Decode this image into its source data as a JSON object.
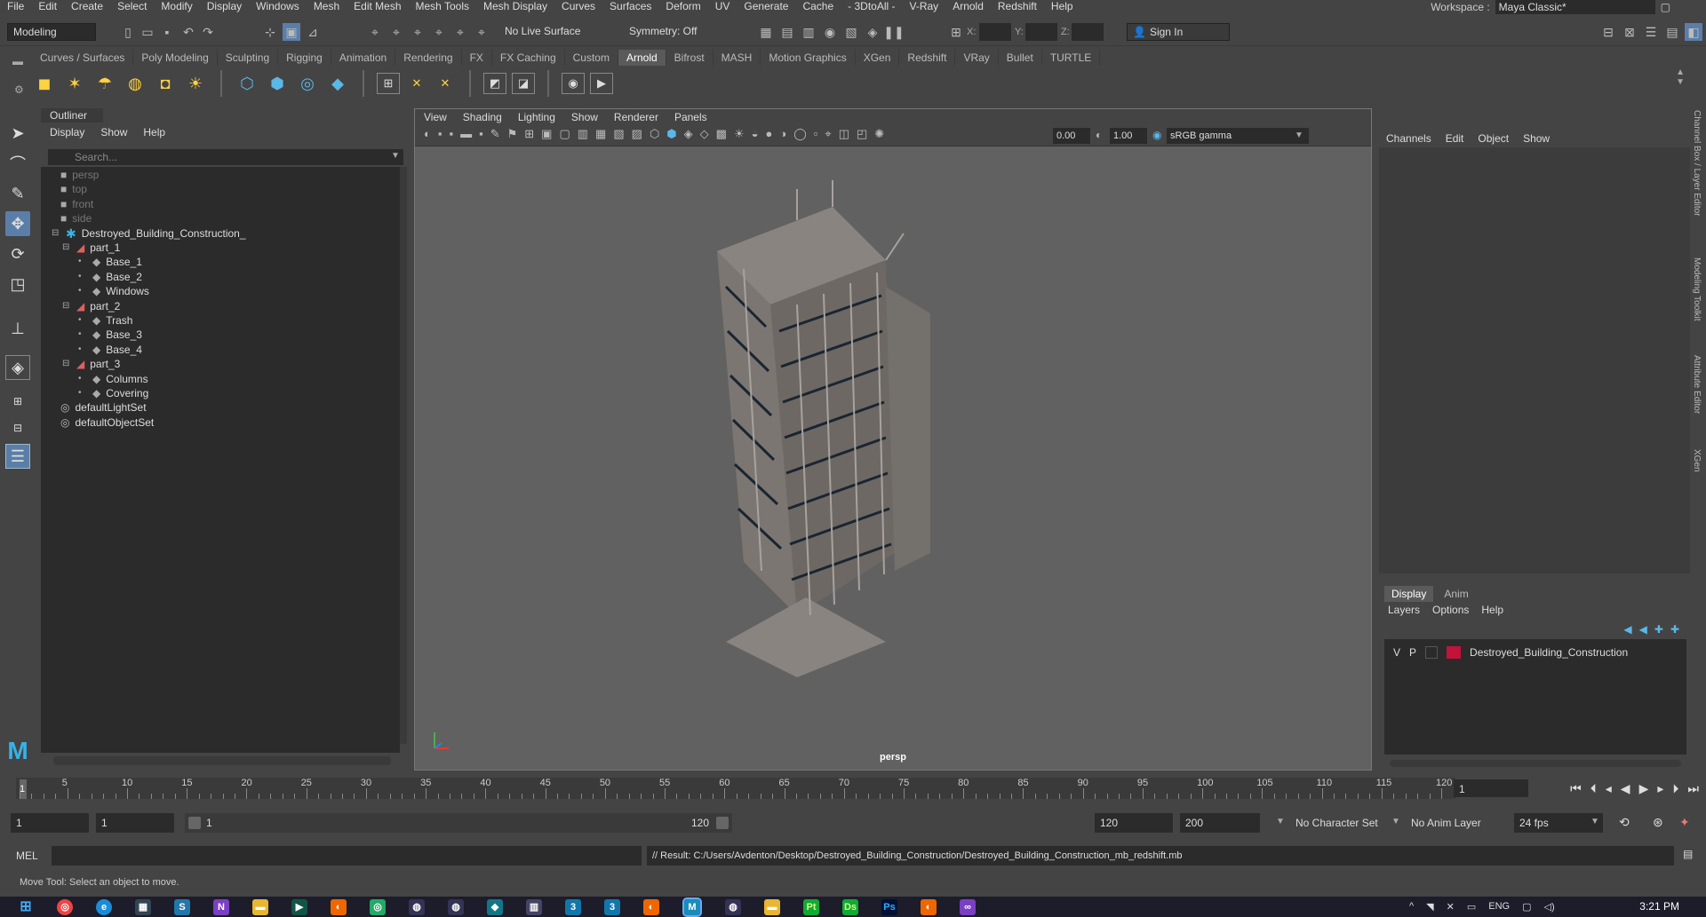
{
  "menubar": [
    "File",
    "Edit",
    "Create",
    "Select",
    "Modify",
    "Display",
    "Windows",
    "Mesh",
    "Edit Mesh",
    "Mesh Tools",
    "Mesh Display",
    "Curves",
    "Surfaces",
    "Deform",
    "UV",
    "Generate",
    "Cache",
    "- 3DtoAll -",
    "V-Ray",
    "Arnold",
    "Redshift",
    "Help"
  ],
  "workspace": {
    "label": "Workspace :",
    "value": "Maya Classic*"
  },
  "status": {
    "mode": "Modeling",
    "live_surface": "No Live Surface",
    "symmetry": "Symmetry: Off",
    "sign_in": "Sign In",
    "x_label": "X:",
    "y_label": "Y:",
    "z_label": "Z:"
  },
  "shelf_tabs": [
    "Curves / Surfaces",
    "Poly Modeling",
    "Sculpting",
    "Rigging",
    "Animation",
    "Rendering",
    "FX",
    "FX Caching",
    "Custom",
    "Arnold",
    "Bifrost",
    "MASH",
    "Motion Graphics",
    "XGen",
    "Redshift",
    "VRay",
    "Bullet",
    "TURTLE"
  ],
  "shelf_active": "Arnold",
  "outliner": {
    "title": "Outliner",
    "menu": [
      "Display",
      "Show",
      "Help"
    ],
    "search_placeholder": "Search...",
    "items": [
      {
        "label": "persp",
        "icon": "camera-icon",
        "depth": 0,
        "dim": true
      },
      {
        "label": "top",
        "icon": "camera-icon",
        "depth": 0,
        "dim": true
      },
      {
        "label": "front",
        "icon": "camera-icon",
        "depth": 0,
        "dim": true
      },
      {
        "label": "side",
        "icon": "camera-icon",
        "depth": 0,
        "dim": true
      },
      {
        "label": "Destroyed_Building_Construction_",
        "icon": "group-icon",
        "depth": 0,
        "exp": "−"
      },
      {
        "label": "part_1",
        "icon": "transform-icon",
        "depth": 1,
        "exp": "−"
      },
      {
        "label": "Base_1",
        "icon": "mesh-icon",
        "depth": 2
      },
      {
        "label": "Base_2",
        "icon": "mesh-icon",
        "depth": 2
      },
      {
        "label": "Windows",
        "icon": "mesh-icon",
        "depth": 2
      },
      {
        "label": "part_2",
        "icon": "transform-icon",
        "depth": 1,
        "exp": "−"
      },
      {
        "label": "Trash",
        "icon": "mesh-icon",
        "depth": 2
      },
      {
        "label": "Base_3",
        "icon": "mesh-icon",
        "depth": 2
      },
      {
        "label": "Base_4",
        "icon": "mesh-icon",
        "depth": 2
      },
      {
        "label": "part_3",
        "icon": "transform-icon",
        "depth": 1,
        "exp": "−"
      },
      {
        "label": "Columns",
        "icon": "mesh-icon",
        "depth": 2
      },
      {
        "label": "Covering",
        "icon": "mesh-icon",
        "depth": 2
      },
      {
        "label": "defaultLightSet",
        "icon": "set-icon",
        "depth": 0
      },
      {
        "label": "defaultObjectSet",
        "icon": "set-icon",
        "depth": 0
      }
    ]
  },
  "viewport": {
    "menu": [
      "View",
      "Shading",
      "Lighting",
      "Show",
      "Renderer",
      "Panels"
    ],
    "exposure": "0.00",
    "gamma": "1.00",
    "colorspace": "sRGB gamma",
    "camera_label": "persp"
  },
  "channel_box": {
    "menu": [
      "Channels",
      "Edit",
      "Object",
      "Show"
    ]
  },
  "layer_editor": {
    "tabs": [
      "Display",
      "Anim"
    ],
    "menu": [
      "Layers",
      "Options",
      "Help"
    ],
    "layer": {
      "v": "V",
      "p": "P",
      "name": "Destroyed_Building_Construction",
      "color": "#c4123a"
    }
  },
  "side_tabs": [
    "Channel Box / Layer Editor",
    "Modeling Toolkit",
    "Attribute Editor",
    "XGen"
  ],
  "timeline": {
    "ticks": [
      "1",
      "5",
      "10",
      "15",
      "20",
      "25",
      "30",
      "35",
      "40",
      "45",
      "50",
      "55",
      "60",
      "65",
      "70",
      "75",
      "80",
      "85",
      "90",
      "95",
      "100",
      "105",
      "110",
      "115",
      "120"
    ],
    "current": "1",
    "current_field": "1"
  },
  "range": {
    "start": "1",
    "playback_start": "1",
    "slider_start": "1",
    "slider_end": "120",
    "playback_end": "120",
    "end": "200",
    "character_set": "No Character Set",
    "anim_layer": "No Anim Layer",
    "fps": "24 fps"
  },
  "command": {
    "lang": "MEL",
    "result": "// Result: C:/Users/Avdenton/Desktop/Destroyed_Building_Construction/Destroyed_Building_Construction_mb_redshift.mb"
  },
  "help_line": "Move Tool: Select an object to move.",
  "taskbar": {
    "lang": "ENG",
    "time": "3:21 PM"
  }
}
